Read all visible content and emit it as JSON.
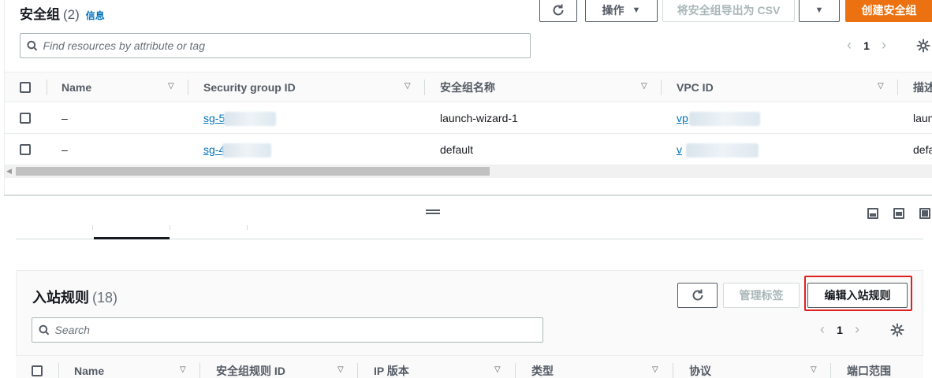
{
  "top_panel": {
    "title": "安全组",
    "count": "(2)",
    "info_link": "信息",
    "buttons": {
      "refresh_icon": "refresh-icon",
      "actions": "操作",
      "export_csv": "将安全组导出为 CSV",
      "create": "创建安全组"
    },
    "search": {
      "placeholder": "Find resources by attribute or tag"
    },
    "pagination": {
      "current_page": "1"
    },
    "columns": [
      "Name",
      "Security group ID",
      "安全组名称",
      "VPC ID",
      "描述"
    ],
    "rows": [
      {
        "name": "–",
        "sg_id": "sg-5",
        "sg_name": "launch-wizard-1",
        "vpc_id": "vp",
        "description": "laun"
      },
      {
        "name": "–",
        "sg_id": "sg-4",
        "sg_name": "default",
        "vpc_id": "v",
        "description": "defa"
      }
    ]
  },
  "bottom_panel": {
    "title": "入站规则",
    "count": "(18)",
    "buttons": {
      "refresh_icon": "refresh-icon",
      "manage_tags": "管理标签",
      "edit_inbound": "编辑入站规则"
    },
    "search": {
      "placeholder": "Search"
    },
    "pagination": {
      "current_page": "1"
    },
    "columns": [
      "Name",
      "安全组规则 ID",
      "IP 版本",
      "类型",
      "协议",
      "端口范围"
    ]
  },
  "colors": {
    "primary_orange": "#ec7211",
    "link_blue": "#0073bb",
    "highlight_red": "#e02020",
    "text_dark": "#16191f",
    "text_muted": "#545b64"
  }
}
